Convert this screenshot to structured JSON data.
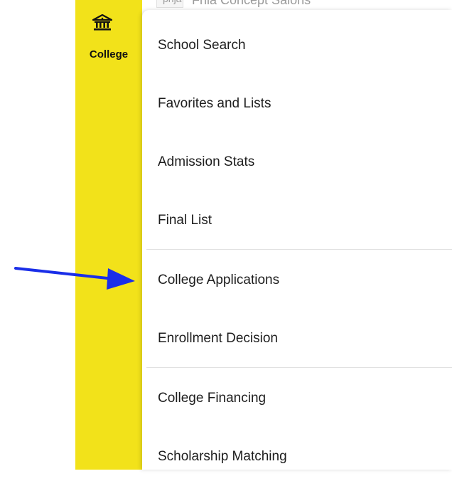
{
  "background_app": {
    "row_text": "Fnia Concept Salons",
    "row_code": "pnja"
  },
  "sidebar": {
    "section_icon": "bank-building-icon",
    "section_label": "College",
    "accent_color": "#f2e21a"
  },
  "menu": {
    "items": [
      {
        "label": "School Search"
      },
      {
        "label": "Favorites and Lists"
      },
      {
        "label": "Admission Stats"
      },
      {
        "label": "Final List"
      },
      {
        "label": "College Applications"
      },
      {
        "label": "Enrollment Decision"
      },
      {
        "label": "College Financing"
      },
      {
        "label": "Scholarship Matching"
      }
    ]
  },
  "annotation": {
    "arrow_color": "#1a2ee8",
    "points_to": "College Applications"
  }
}
